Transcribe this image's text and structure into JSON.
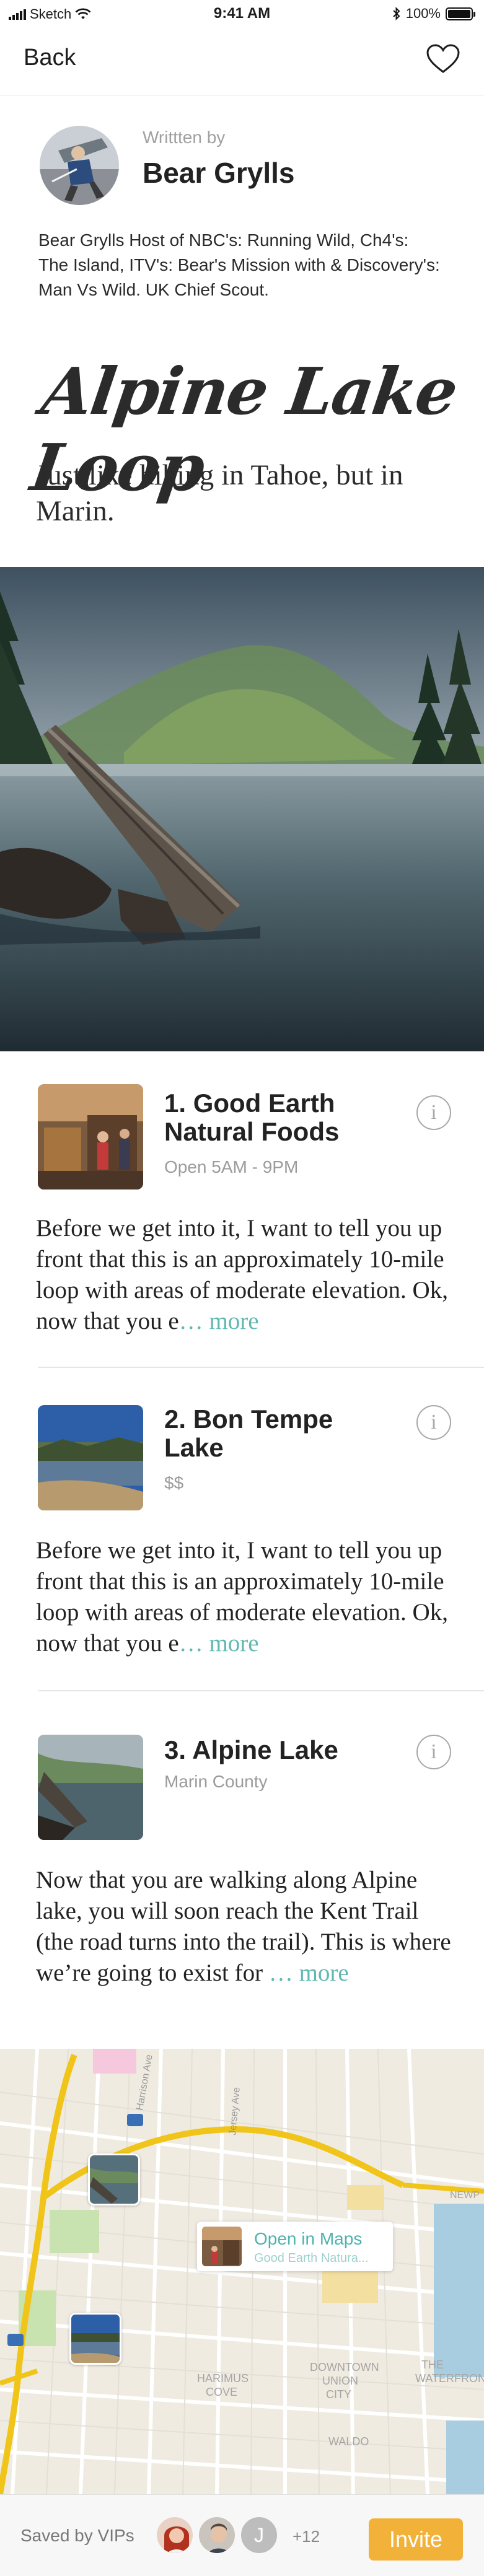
{
  "status_bar": {
    "carrier": "Sketch",
    "time": "9:41 AM",
    "battery": "100%"
  },
  "nav": {
    "back_label": "Back"
  },
  "author": {
    "written_by_label": "Writtten by",
    "name": "Bear Grylls",
    "bio": "Bear Grylls Host of NBC's: Running Wild, Ch4's: The Island, ITV's: Bear's Mission with & Discovery's: Man Vs Wild. UK Chief Scout."
  },
  "trail": {
    "title": "Alpine Lake Loop",
    "subtitle": "Just like hiking in Tahoe, but in Marin."
  },
  "places": [
    {
      "name": "1. Good Earth Natural Foods",
      "meta": "Open 5AM - 9PM",
      "description": "Before we get into it, I want to tell you up front that this is an approximately 10-mile loop with areas of moderate elevation. Ok, now that you e",
      "more_label": "… more"
    },
    {
      "name": "2. Bon Tempe Lake",
      "meta": "$$",
      "description": "Before we get into it, I want to tell you up front that this is an approximately 10-mile loop with areas of moderate elevation. Ok, now that you e",
      "more_label": "… more"
    },
    {
      "name": "3. Alpine Lake",
      "meta": "Marin County",
      "description": "Now that you are walking along Alpine lake, you will soon reach the Kent Trail (the road turns into the trail). This is where we’re going to exist for ",
      "more_label": "… more"
    }
  ],
  "map": {
    "callout_title": "Open in Maps",
    "callout_subtitle": "Good Earth Natura...",
    "labels": [
      "DOWNTOWN UNION CITY",
      "HARIMUS COVE",
      "THE WATERFRONT",
      "WALDO",
      "NEWP",
      "Jersey Ave",
      "Harrison Ave"
    ]
  },
  "bottom_bar": {
    "saved_label": "Saved by VIPs",
    "avatar_initial": "J",
    "extra_count": "+12",
    "invite_label": "Invite"
  }
}
